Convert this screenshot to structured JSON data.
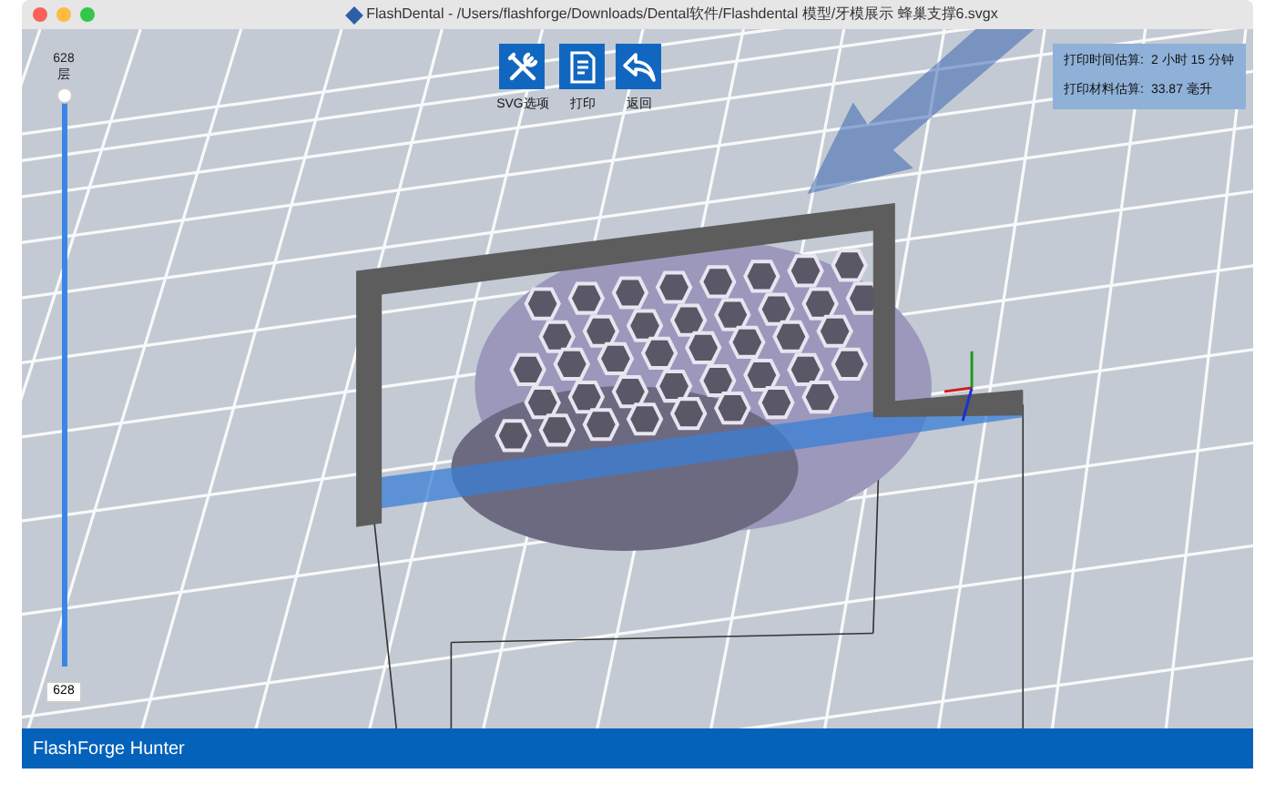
{
  "window": {
    "title": "FlashDental - /Users/flashforge/Downloads/Dental软件/Flashdental 模型/牙模展示 蜂巢支撑6.svgx"
  },
  "toolbar": [
    {
      "kind": "tools",
      "label": "SVG选项"
    },
    {
      "kind": "document",
      "label": "打印"
    },
    {
      "kind": "back",
      "label": "返回"
    }
  ],
  "estimates": [
    {
      "label": "打印时间估算:",
      "value": "2 小时 15 分钟"
    },
    {
      "label": "打印材料估算:",
      "value": "33.87 毫升"
    }
  ],
  "layer_slider": {
    "top_value": "628",
    "top_unit": "层",
    "bottom_value": "628",
    "level": 1
  },
  "status_bar": {
    "text": "FlashForge Hunter"
  }
}
